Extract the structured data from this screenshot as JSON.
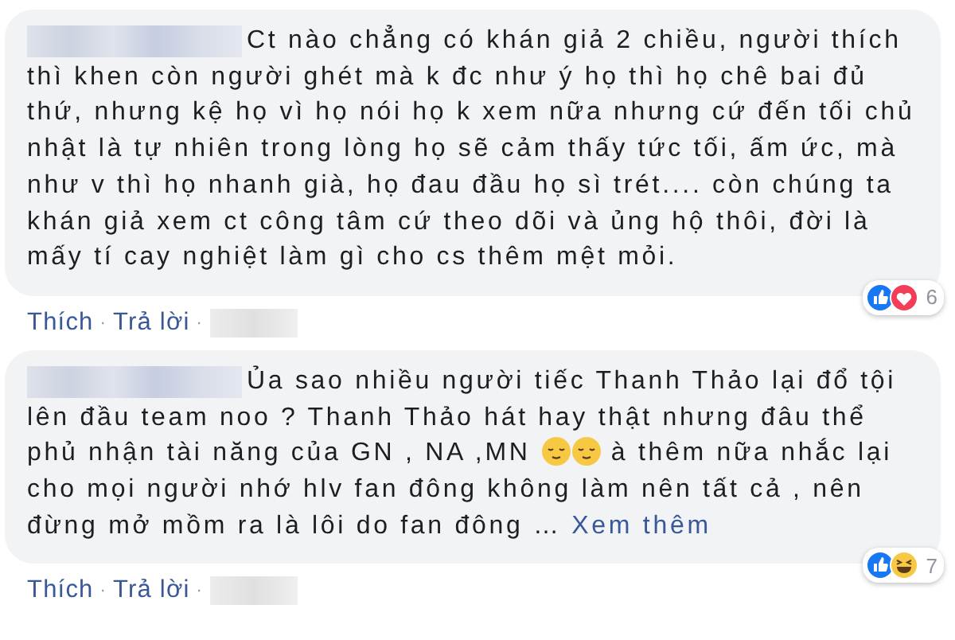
{
  "comments": [
    {
      "body": [
        {
          "kind": "text",
          "text": "Ct nào chẳng có khán giả 2 chiều, người thích thì khen còn người ghét mà k đc như ý họ thì họ chê bai đủ thứ, nhưng kệ họ vì họ nói họ k xem nữa nhưng cứ đến tối chủ nhật là tự nhiên trong lòng họ sẽ cảm thấy tức tối, ấm ức, mà như v thì họ nhanh già, họ đau đầu họ sì trét.... còn chúng ta khán giả xem ct công tâm cứ theo dõi và ủng hộ thôi, đời là mấy tí cay nghiệt làm gì cho cs thêm mệt mỏi."
        }
      ],
      "reactions": [
        {
          "kind": "like"
        },
        {
          "kind": "love"
        }
      ],
      "reaction_count": "6",
      "actions": [
        "Thích",
        "Trả lời"
      ],
      "separator": "·"
    },
    {
      "body": [
        {
          "kind": "text",
          "text": "Ủa sao nhiều người tiếc Thanh Thảo lại đổ tội lên đầu team noo ? Thanh Thảo hát hay thật nhưng đâu thể phủ nhận tài năng của GN , NA ,MN "
        },
        {
          "kind": "emoji"
        },
        {
          "kind": "emoji"
        },
        {
          "kind": "text",
          "text": " à thêm nữa nhắc lại cho mọi người nhớ hlv fan đông không làm nên tất cả , nên đừng mở mồm ra là lôi do fan đông … "
        },
        {
          "kind": "link",
          "text": "Xem thêm"
        }
      ],
      "reactions": [
        {
          "kind": "like"
        },
        {
          "kind": "haha"
        }
      ],
      "reaction_count": "7",
      "actions": [
        "Thích",
        "Trả lời"
      ],
      "separator": "·"
    }
  ]
}
